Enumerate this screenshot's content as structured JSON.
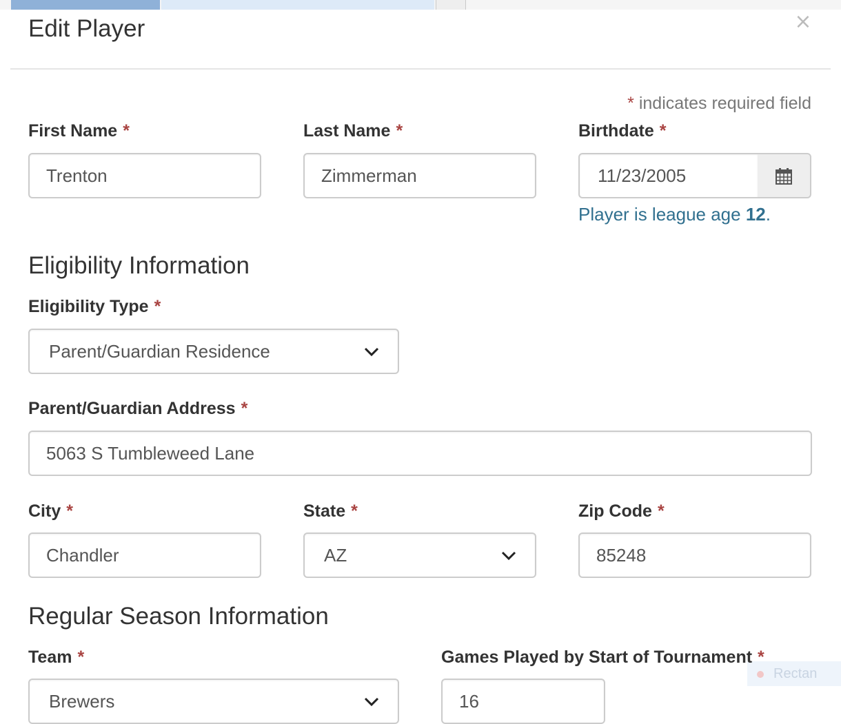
{
  "modal": {
    "title": "Edit Player",
    "close_glyph": "×"
  },
  "required_note": {
    "star": "*",
    "text": " indicates required field"
  },
  "required_star": "*",
  "fields": {
    "first_name": {
      "label": "First Name",
      "value": "Trenton"
    },
    "last_name": {
      "label": "Last Name",
      "value": "Zimmerman"
    },
    "birthdate": {
      "label": "Birthdate",
      "value": "11/23/2005",
      "icon": "calendar-icon"
    },
    "eligibility_type": {
      "label": "Eligibility Type",
      "value": "Parent/Guardian Residence"
    },
    "guardian_address": {
      "label": "Parent/Guardian Address",
      "value": "5063 S Tumbleweed Lane"
    },
    "city": {
      "label": "City",
      "value": "Chandler"
    },
    "state": {
      "label": "State",
      "value": "AZ"
    },
    "zip": {
      "label": "Zip Code",
      "value": "85248"
    },
    "team": {
      "label": "Team",
      "value": "Brewers"
    },
    "games_played": {
      "label": "Games Played by Start of Tournament",
      "value": "16"
    }
  },
  "league_age": {
    "prefix": "Player is league age ",
    "age": "12",
    "suffix": "."
  },
  "sections": {
    "eligibility": "Eligibility Information",
    "regular_season": "Regular Season Information"
  },
  "tooltip": {
    "text": "Rectan"
  },
  "colors": {
    "required_star": "#a94442",
    "help_text": "#31708f",
    "border": "#cccccc",
    "addon_bg": "#eeeeee"
  }
}
